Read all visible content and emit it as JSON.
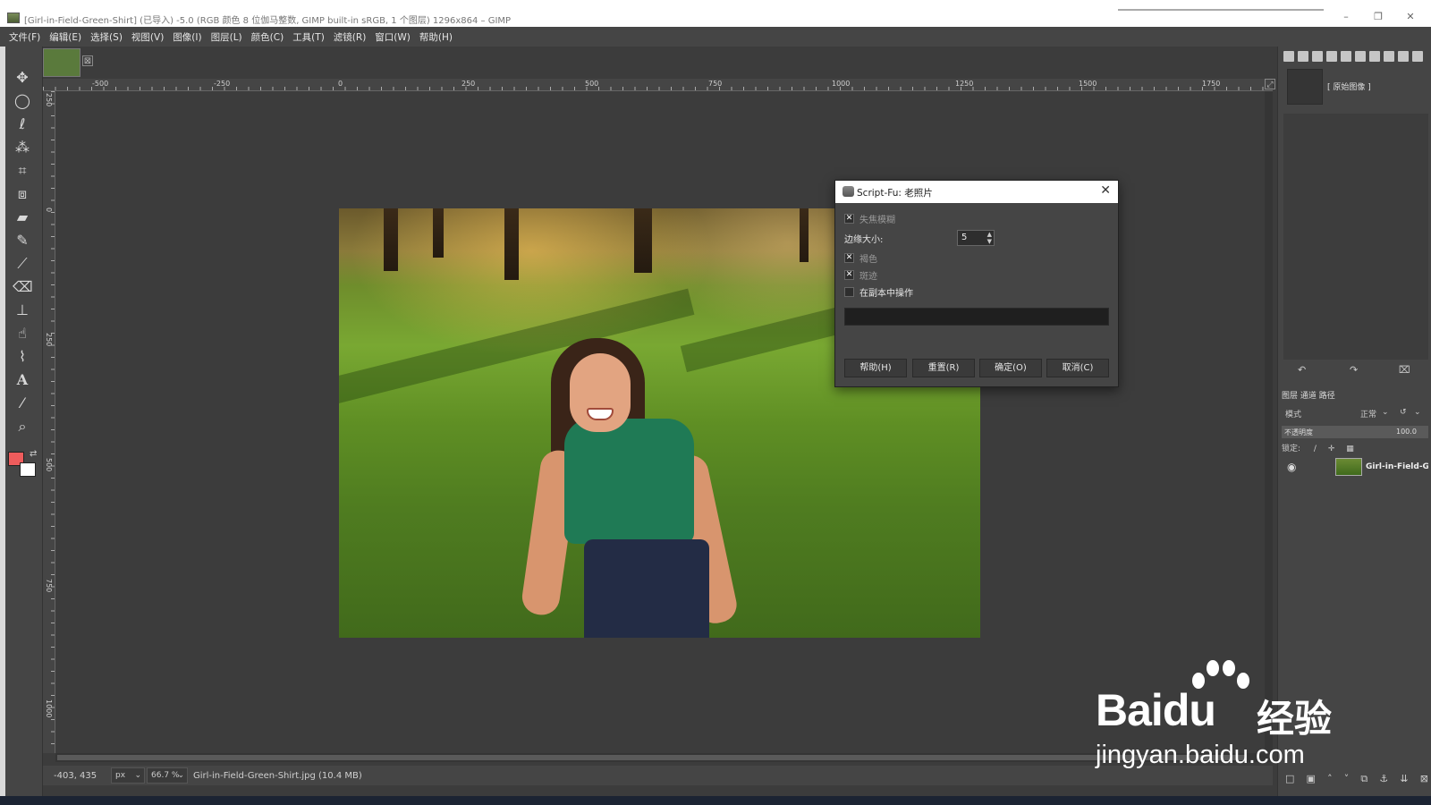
{
  "window": {
    "title": "[Girl-in-Field-Green-Shirt] (已导入) -5.0 (RGB 颜色 8 位伽马整数, GIMP built-in sRGB, 1 个图层) 1296x864 – GIMP",
    "minimize": "–",
    "maximize": "❐",
    "close": "✕"
  },
  "menu": [
    "文件(F)",
    "编辑(E)",
    "选择(S)",
    "视图(V)",
    "图像(I)",
    "图层(L)",
    "颜色(C)",
    "工具(T)",
    "滤镜(R)",
    "窗口(W)",
    "帮助(H)"
  ],
  "image_tab": {
    "close": "⊠"
  },
  "ruler_top": [
    "-500",
    "-250",
    "0",
    "250",
    "500",
    "750",
    "1000",
    "1250",
    "1500",
    "1750"
  ],
  "ruler_left": [
    "250",
    "0",
    "250",
    "500",
    "750",
    "1000"
  ],
  "toolbox": {
    "icons": [
      "move-icon",
      "ellipse-select-icon",
      "lasso-icon",
      "fuzzy-select-icon",
      "crop-icon",
      "transform-icon",
      "bucket-fill-icon",
      "ink-icon",
      "paintbrush-icon",
      "eraser-icon",
      "clone-icon",
      "smudge-icon",
      "paths-icon",
      "text-icon",
      "color-picker-icon",
      "zoom-icon"
    ],
    "foreground_color": "#ee5c5c",
    "background_color": "#ffffff"
  },
  "statusbar": {
    "coords": "-403, 435",
    "unit": "px",
    "zoom": "66.7 %",
    "file": "Girl-in-Field-Green-Shirt.jpg (10.4 MB)"
  },
  "dialog": {
    "title": "Script-Fu: 老照片",
    "close": "✕",
    "defocus_label": "失焦模糊",
    "border_size_label": "边缘大小:",
    "border_size_value": "5",
    "sepia_label": "褐色",
    "mottle_label": "斑迹",
    "work_on_copy_label": "在副本中操作",
    "buttons": {
      "help": "帮助(H)",
      "reset": "重置(R)",
      "ok": "确定(O)",
      "cancel": "取消(C)"
    }
  },
  "dock": {
    "snapshot_label": "[ 原始图像 ]",
    "tabs": "图层  通道  路径",
    "mode_label": "模式",
    "mode_value": "正常",
    "opacity_label": "不透明度",
    "opacity_value": "100.0",
    "lock_label": "锁定:",
    "layer_name": "Girl-in-Field-Green-Shirt"
  },
  "watermark": {
    "brand": "Bai",
    "brand_du": "du",
    "brand_cn": "经验",
    "url": "jingyan.baidu.com"
  }
}
